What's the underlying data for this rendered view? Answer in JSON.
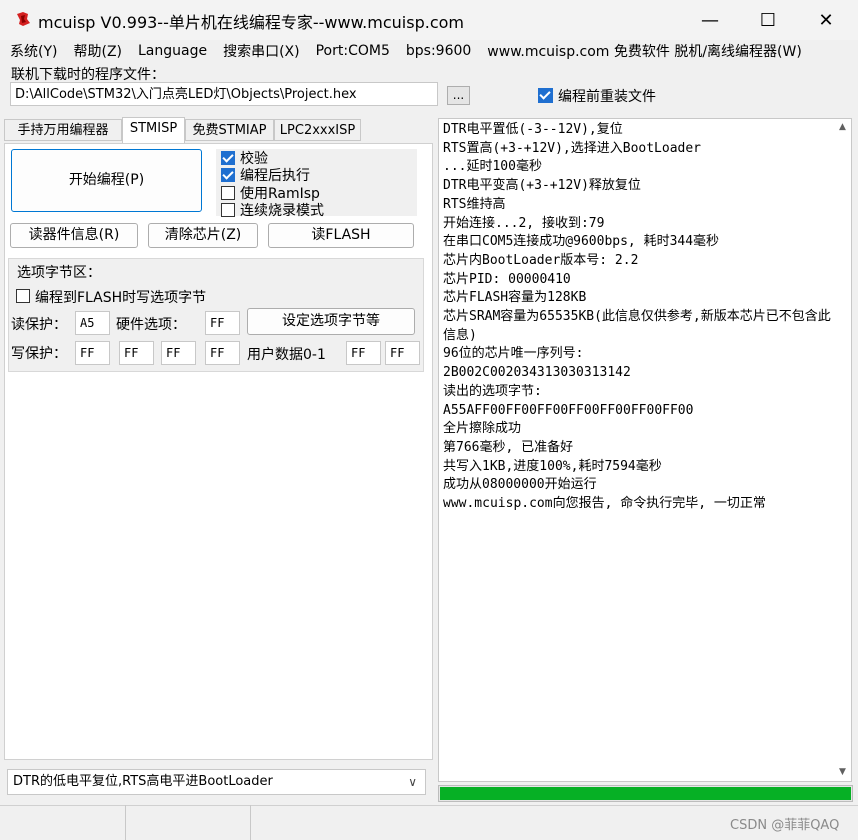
{
  "window": {
    "title": "mcuisp V0.993--单片机在线编程专家--www.mcuisp.com",
    "minimize_glyph": "—",
    "maximize_glyph": "☐",
    "close_glyph": "✕"
  },
  "menu": [
    "系统(Y)",
    "帮助(Z)",
    "Language",
    "搜索串口(X)",
    "Port:COM5",
    "bps:9600",
    "www.mcuisp.com 免费软件 脱机/离线编程器(W)"
  ],
  "file": {
    "label": "联机下载时的程序文件：",
    "path": "D:\\AllCode\\STM32\\入门点亮LED灯\\Objects\\Project.hex",
    "browse_label": "...",
    "reload_label": "编程前重装文件",
    "reload_checked": true
  },
  "tabs": [
    {
      "label": "手持万用编程器",
      "active": false
    },
    {
      "label": "STMISP",
      "active": true
    },
    {
      "label": "免费STMIAP",
      "active": false
    },
    {
      "label": "LPC2xxxISP",
      "active": false
    }
  ],
  "stmisp": {
    "start_label": "开始编程(P)",
    "options": [
      {
        "label": "校验",
        "checked": true
      },
      {
        "label": "编程后执行",
        "checked": true
      },
      {
        "label": "使用RamIsp",
        "checked": false
      },
      {
        "label": "连续烧录模式",
        "checked": false
      }
    ],
    "read_info_label": "读器件信息(R)",
    "clear_chip_label": "清除芯片(Z)",
    "read_flash_label": "读FLASH",
    "optbyte": {
      "title": "选项字节区：",
      "flash_write_label": "编程到FLASH时写选项字节",
      "read_protect_label": "读保护：",
      "read_protect_value": "A5",
      "hw_option_label": "硬件选项：",
      "hw_option_value": "FF",
      "set_button_label": "设定选项字节等",
      "write_protect_label": "写保护：",
      "write_protect_values": [
        "FF",
        "FF",
        "FF",
        "FF"
      ],
      "user_data_label": "用户数据0-1",
      "user_data_values": [
        "FF",
        "FF"
      ]
    },
    "mode_select": "DTR的低电平复位,RTS高电平进BootLoader"
  },
  "log": [
    "DTR电平置低(-3--12V),复位",
    "RTS置高(+3-+12V),选择进入BootLoader",
    "...延时100毫秒",
    "DTR电平变高(+3-+12V)释放复位",
    "RTS维持高",
    "开始连接...2, 接收到:79",
    "在串口COM5连接成功@9600bps, 耗时344毫秒",
    "芯片内BootLoader版本号: 2.2",
    "芯片PID: 00000410",
    "芯片FLASH容量为128KB",
    "芯片SRAM容量为65535KB(此信息仅供参考,新版本芯片已不包含此信息)",
    "96位的芯片唯一序列号:",
    "2B002C002034313030313142",
    "读出的选项字节:",
    "A55AFF00FF00FF00FF00FF00FF00FF00",
    "全片擦除成功",
    "第766毫秒, 已准备好",
    "共写入1KB,进度100%,耗时7594毫秒",
    "成功从08000000开始运行",
    "www.mcuisp.com向您报告, 命令执行完毕, 一切正常"
  ],
  "progress_fraction": 1.0,
  "watermark": "CSDN @菲菲QAQ",
  "colors": {
    "progress": "#06b025",
    "checkbox": "#1f6fd0",
    "icon_red": "#d42020"
  }
}
